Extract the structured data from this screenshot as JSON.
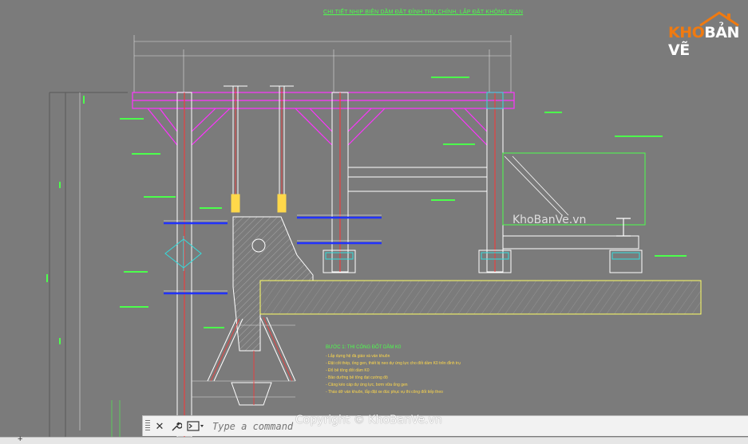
{
  "drawing": {
    "title": "CHI TIẾT NHỊP BIÊN DẦM ĐẶT ĐỈNH TRỤ CHÍNH, LẮP ĐẶT KHÔNG GIAN",
    "watermark": "KhoBanVe.vn",
    "notes_heading": "BƯỚC 1: THI CÔNG ĐỐT DẦM K0",
    "notes": [
      "- Lắp dựng hệ đà giáo và ván khuôn",
      "- Đặt cốt thép, ống gen, thiết bị neo dự ứng lực cho đốt dầm K0 trên đỉnh trụ",
      "- Đổ bê tông đốt dầm K0",
      "- Bảo dưỡng bê tông đạt cường độ",
      "- Căng kéo cáp dự ứng lực, bơm vữa ống gen",
      "- Tháo dỡ ván khuôn, lắp đặt xe đúc phục vụ thi công đốt tiếp theo"
    ]
  },
  "logo": {
    "part1": "KHO",
    "part2": "BẢN VẼ"
  },
  "command_line": {
    "placeholder": "Type a command",
    "close_icon": "close-icon",
    "settings_icon": "wrench-icon",
    "prompt_icon": "command-prompt-icon"
  },
  "footer": {
    "copyright": "Copyright © KhoBanVe.vn"
  },
  "colors": {
    "background": "#7b7b7b",
    "beam": "#ff33ff",
    "green_annotation": "#4cff4c",
    "blue_strut": "#2233ff",
    "yellow_line": "#ffff66",
    "cyan": "#33dddd",
    "red_axis": "#ff3333"
  }
}
